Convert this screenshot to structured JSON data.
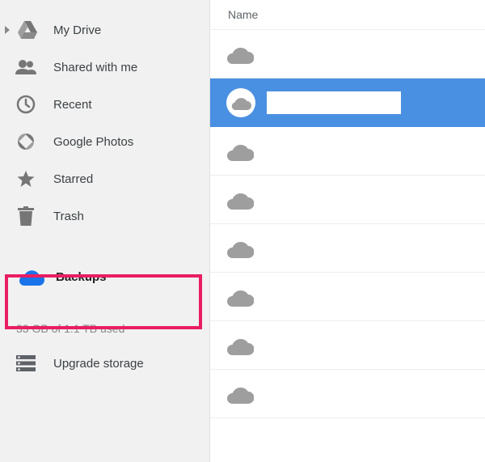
{
  "sidebar": {
    "items": [
      {
        "label": "My Drive"
      },
      {
        "label": "Shared with me"
      },
      {
        "label": "Recent"
      },
      {
        "label": "Google Photos"
      },
      {
        "label": "Starred"
      },
      {
        "label": "Trash"
      },
      {
        "label": "Backups"
      }
    ],
    "storage_text": "33 GB of 1.1 TB used",
    "upgrade_label": "Upgrade storage"
  },
  "main": {
    "column_header": "Name",
    "items": [
      {
        "selected": false
      },
      {
        "selected": true
      },
      {
        "selected": false
      },
      {
        "selected": false
      },
      {
        "selected": false
      },
      {
        "selected": false
      },
      {
        "selected": false
      },
      {
        "selected": false
      }
    ]
  },
  "colors": {
    "accent_blue": "#1a73e8",
    "highlight": "#e91e63",
    "selected_bg": "#4a90e2",
    "icon_gray": "#767676"
  }
}
